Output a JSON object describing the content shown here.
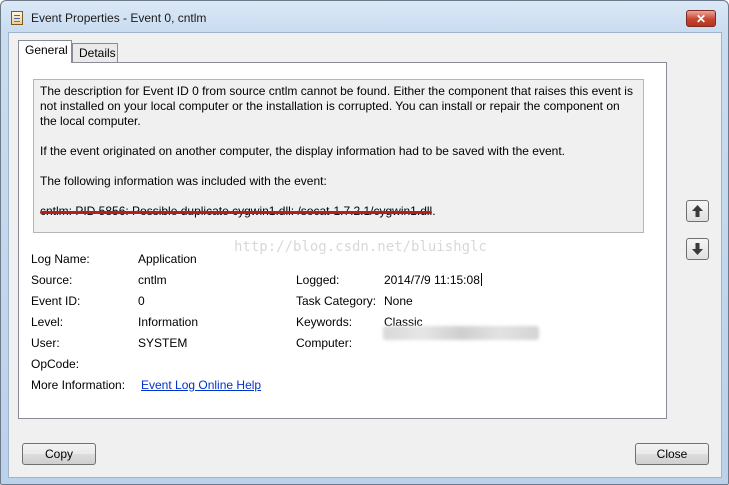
{
  "window": {
    "title": "Event Properties - Event 0, cntlm",
    "close_glyph": "✕"
  },
  "tabs": [
    {
      "label": "General",
      "active": true
    },
    {
      "label": "Details",
      "active": false
    }
  ],
  "description": {
    "para1": "The description for Event ID 0 from source cntlm cannot be found. Either the component that raises this event is not installed on your local computer or the installation is corrupted. You can install or repair the component on the local computer.",
    "para2": "If the event originated on another computer, the display information had to be saved with the event.",
    "para3": "The following information was included with the event:",
    "highlight": "cntlm: PID 5856: Possible duplicate cygwin1.dll: /socat-1.7.2.1/cygwin1.dll."
  },
  "watermark": "http://blog.csdn.net/bluishglc",
  "fields": {
    "log_name_label": "Log Name:",
    "log_name_value": "Application",
    "source_label": "Source:",
    "source_value": "cntlm",
    "logged_label": "Logged:",
    "logged_value": "2014/7/9 11:15:08",
    "event_id_label": "Event ID:",
    "event_id_value": "0",
    "task_category_label": "Task Category:",
    "task_category_value": "None",
    "level_label": "Level:",
    "level_value": "Information",
    "keywords_label": "Keywords:",
    "keywords_value": "Classic",
    "user_label": "User:",
    "user_value": "SYSTEM",
    "computer_label": "Computer:",
    "opcode_label": "OpCode:",
    "more_info_label": "More Information:",
    "more_info_link": "Event Log Online Help"
  },
  "buttons": {
    "copy": "Copy",
    "close": "Close"
  },
  "icons": {
    "app": "event-viewer-icon",
    "up": "arrow-up-icon",
    "down": "arrow-down-icon"
  }
}
